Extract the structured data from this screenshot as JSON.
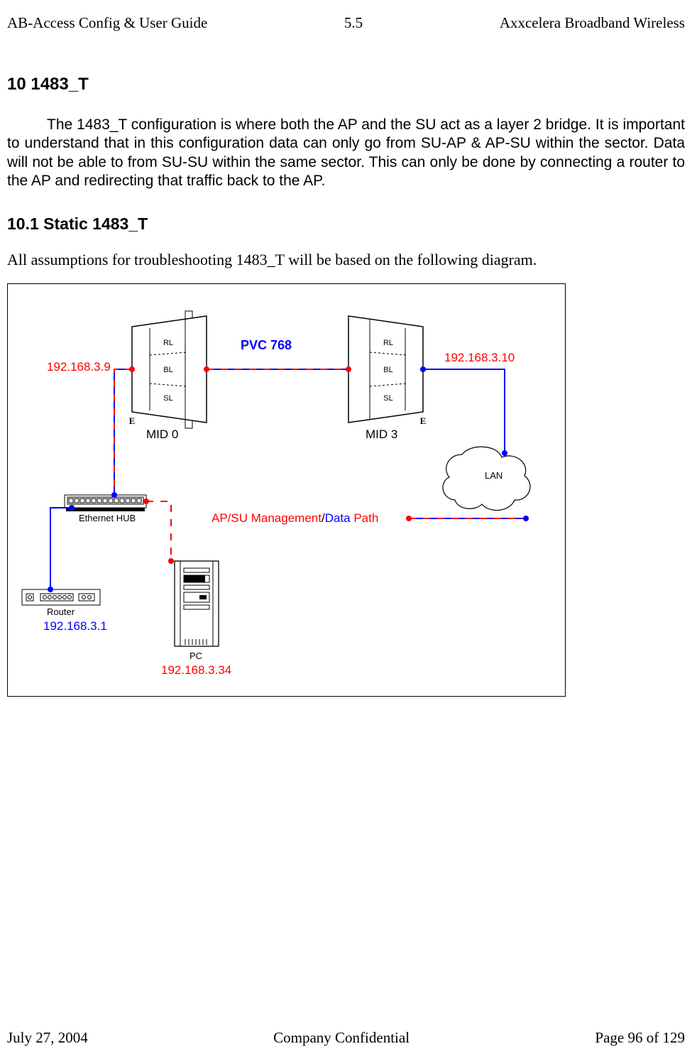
{
  "header": {
    "left": "AB-Access Config & User Guide",
    "center": "5.5",
    "right": "Axxcelera Broadband Wireless"
  },
  "footer": {
    "left": "July 27, 2004",
    "center": "Company Confidential",
    "right": "Page 96 of 129"
  },
  "section": {
    "num": "10",
    "title": "1483_T",
    "h1": "10  1483_T",
    "paragraph": "The 1483_T configuration is where both the AP and the SU act as a layer 2 bridge. It is important to understand that in this configuration data can only go from SU-AP & AP-SU within the sector. Data will not be able to from SU-SU within the same sector. This can only be done by connecting a router to the AP and redirecting that traffic back to the AP.",
    "sub_h2": "10.1 Static 1483_T",
    "sub_text": "All assumptions for troubleshooting 1483_T will be based on the following diagram."
  },
  "diagram": {
    "ap_ip": "192.168.3.9",
    "su_ip": "192.168.3.10",
    "router_ip": "192.168.3.1",
    "pc_ip": "192.168.3.34",
    "pvc": "PVC 768",
    "mid0": "MID 0",
    "mid3": "MID 3",
    "lan": "LAN",
    "hub": "Ethernet HUB",
    "router": "Router",
    "pc": "PC",
    "mgmt_label_pre": "AP/SU  Management",
    "mgmt_label_mid": "/",
    "mgmt_label_data": "Data",
    "mgmt_label_post": " Path",
    "layers": {
      "rl": "RL",
      "bl": "BL",
      "sl": "SL"
    },
    "e_label": "E"
  },
  "chart_data": {
    "type": "diagram",
    "nodes": [
      {
        "id": "ap",
        "label": "MID 0",
        "ip": "192.168.3.9",
        "layers": [
          "RL",
          "BL",
          "SL"
        ],
        "port": "E"
      },
      {
        "id": "su",
        "label": "MID 3",
        "ip": "192.168.3.10",
        "layers": [
          "RL",
          "BL",
          "SL"
        ],
        "port": "E"
      },
      {
        "id": "hub",
        "label": "Ethernet HUB"
      },
      {
        "id": "router",
        "label": "Router",
        "ip": "192.168.3.1"
      },
      {
        "id": "pc",
        "label": "PC",
        "ip": "192.168.3.34"
      },
      {
        "id": "lan",
        "label": "LAN"
      }
    ],
    "links": [
      {
        "from": "ap",
        "to": "su",
        "via": "radio",
        "label": "PVC 768",
        "style": "management+data"
      },
      {
        "from": "ap",
        "to": "hub",
        "via": "ethernet",
        "style": "management+data"
      },
      {
        "from": "hub",
        "to": "router",
        "via": "ethernet",
        "style": "data"
      },
      {
        "from": "hub",
        "to": "pc",
        "via": "ethernet",
        "style": "management"
      },
      {
        "from": "su",
        "to": "lan",
        "via": "ethernet",
        "style": "data"
      }
    ],
    "legend": "AP/SU Management/Data Path"
  }
}
